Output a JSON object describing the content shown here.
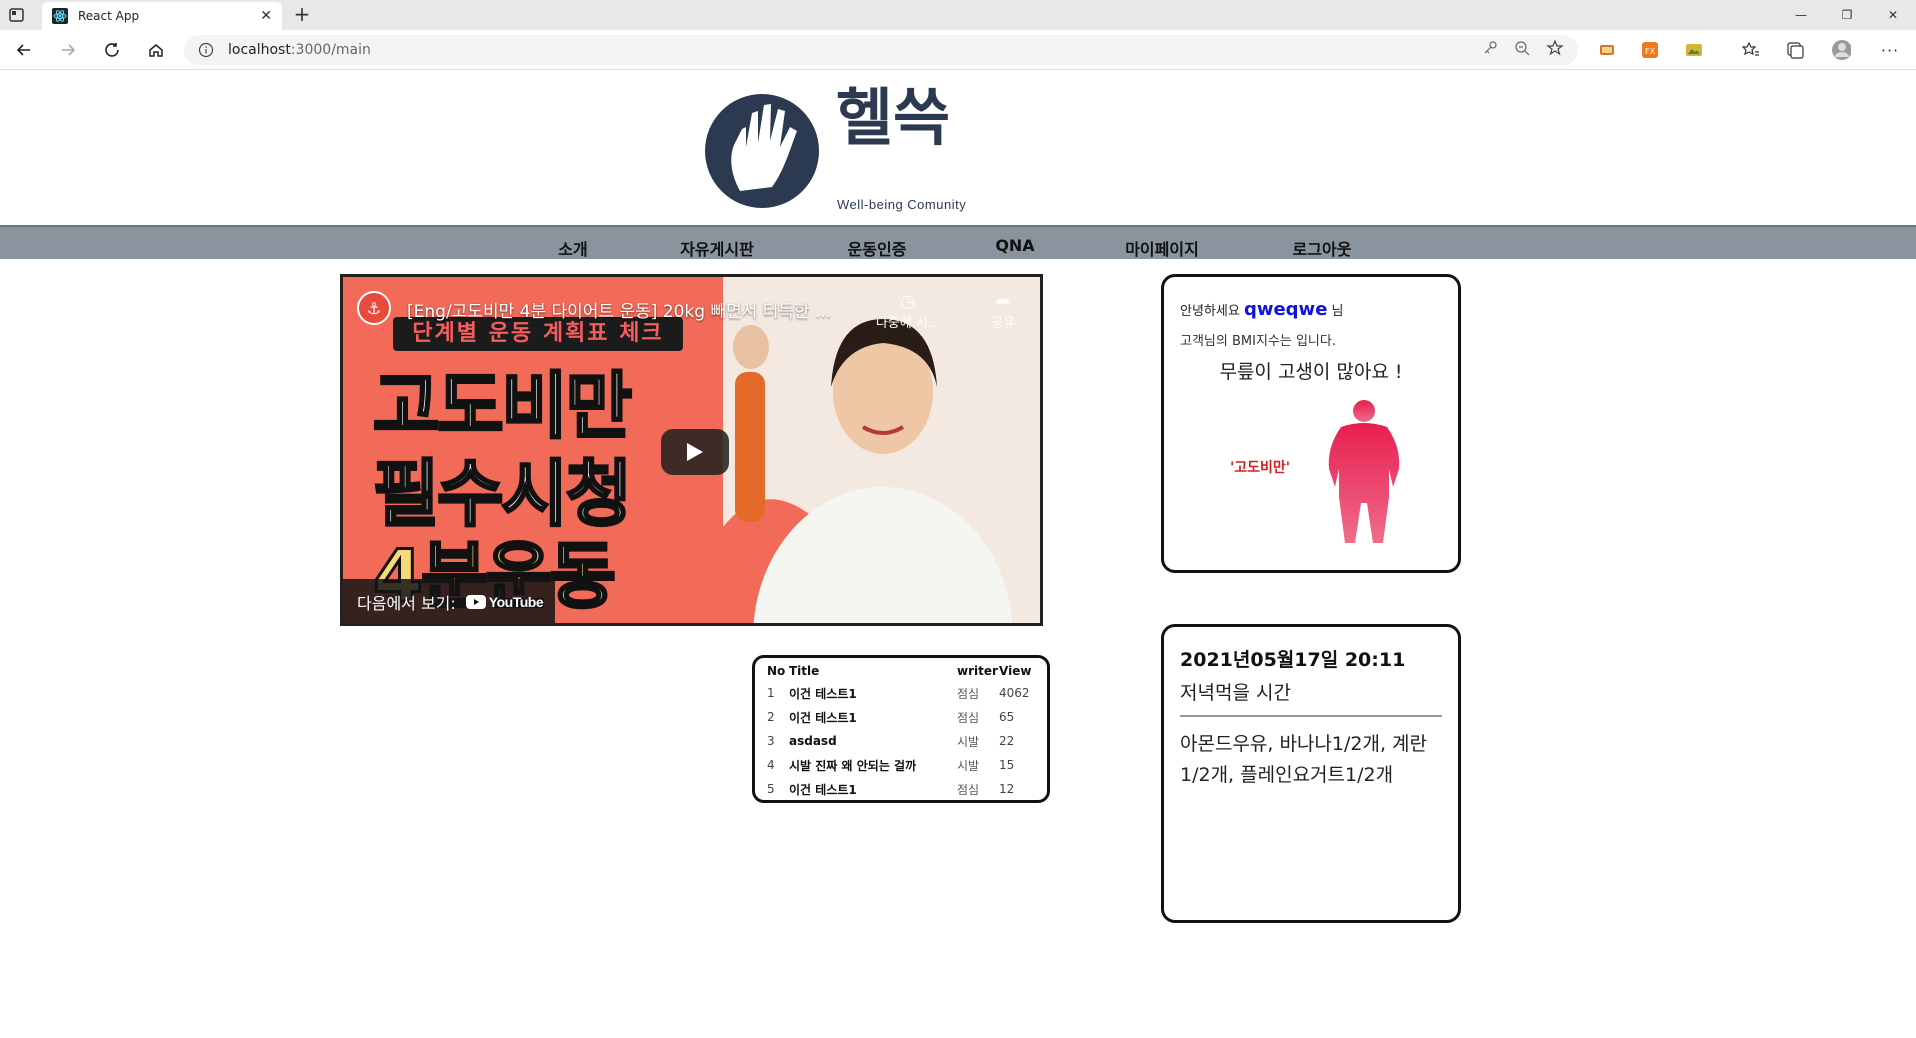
{
  "browser": {
    "tab_title": "React App",
    "url_host": "localhost",
    "url_path": ":3000/main"
  },
  "brand": {
    "name": "헬쓱",
    "subtitle": "Well-being Comunity"
  },
  "nav": {
    "items": [
      "소개",
      "자유게시판",
      "운동인증",
      "QNA",
      "마이페이지",
      "로그아웃"
    ]
  },
  "video": {
    "title": "[Eng/고도비만 4분 다이어트 운동] 20kg 빼면서 터득한 ...",
    "later_label": "나중에 시...",
    "share_label": "공유",
    "watch_on_label": "다음에서 보기:",
    "youtube_label": "YouTube",
    "banner": "단계별 운동 계획표 체크",
    "thumb_lines": [
      "고도비만",
      "필수시청",
      "4분운동"
    ]
  },
  "board": {
    "headers": {
      "no": "No",
      "title": "Title",
      "writer": "writer",
      "views": "View"
    },
    "rows": [
      {
        "no": "1",
        "title": "이건 테스트1",
        "writer": "점심",
        "views": "4062"
      },
      {
        "no": "2",
        "title": "이건 테스트1",
        "writer": "점심",
        "views": "65"
      },
      {
        "no": "3",
        "title": "asdasd",
        "writer": "시발",
        "views": "22"
      },
      {
        "no": "4",
        "title": "시발 진짜 왜 안되는 걸까",
        "writer": "시발",
        "views": "15"
      },
      {
        "no": "5",
        "title": "이건 테스트1",
        "writer": "점심",
        "views": "12"
      }
    ]
  },
  "bmi_card": {
    "greeting_prefix": "안녕하세요",
    "username": "qweqwe",
    "greeting_suffix": "님",
    "bmi_line": "고객님의 BMI지수는 입니다.",
    "message": "무릎이 고생이 많아요 !",
    "category": "'고도비만'"
  },
  "meal_card": {
    "datetime": "2021년05월17일 20:11",
    "subtitle": "저녁먹을 시간",
    "items": "아몬드우유, 바나나1/2개, 계란1/2개, 플레인요거트1/2개"
  },
  "colors": {
    "nav_bg": "#8a949e",
    "username": "#1010e0",
    "bmi_category": "#d42020",
    "logo": "#2b3a50",
    "figure": "#e0245e"
  }
}
